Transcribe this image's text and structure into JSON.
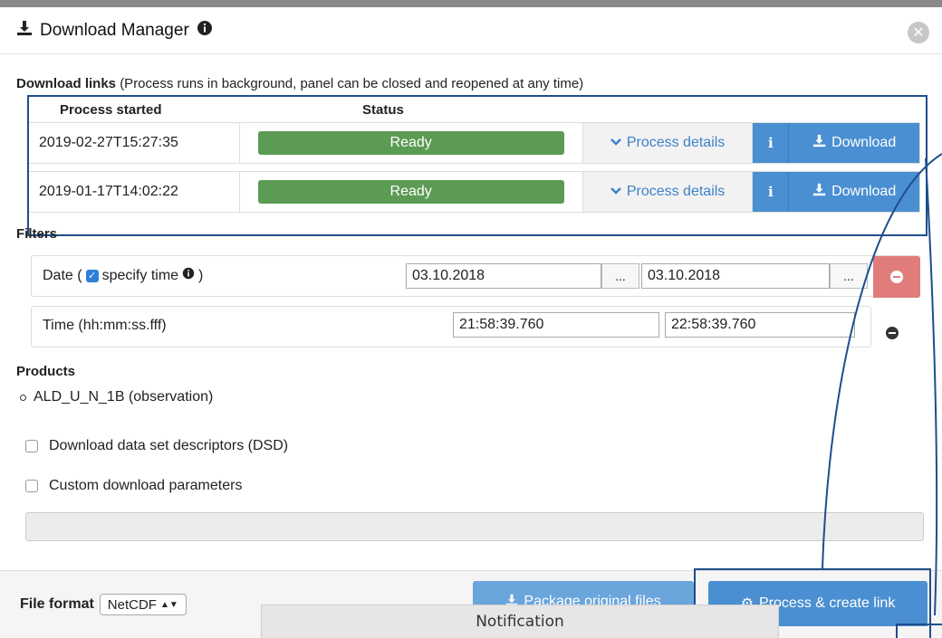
{
  "header": {
    "title": "Download Manager"
  },
  "download_links": {
    "label": "Download links",
    "hint": "(Process runs in background, panel can be closed and reopened at any time)",
    "col_started": "Process started",
    "col_status": "Status",
    "rows": [
      {
        "started": "2019-02-27T15:27:35",
        "status": "Ready",
        "details": "Process details",
        "info": "i",
        "download": "Download"
      },
      {
        "started": "2019-01-17T14:02:22",
        "status": "Ready",
        "details": "Process details",
        "info": "i",
        "download": "Download"
      }
    ]
  },
  "filters": {
    "label": "Filters",
    "date": {
      "label_prefix": "Date (",
      "specify_time": "specify time",
      "label_suffix": ")",
      "from": "03.10.2018",
      "to": "03.10.2018",
      "picker": "..."
    },
    "time": {
      "label": "Time (hh:mm:ss.fff)",
      "from": "21:58:39.760",
      "to": "22:58:39.760"
    }
  },
  "products": {
    "label": "Products",
    "items": [
      "ALD_U_N_1B (observation)"
    ]
  },
  "options": {
    "dsd": "Download data set descriptors (DSD)",
    "custom": "Custom download parameters"
  },
  "footer": {
    "file_format_label": "File format",
    "file_format_value": "NetCDF",
    "package_button": "Package original files",
    "process_button": "Process & create link"
  },
  "notification": "Notification",
  "colors": {
    "ready": "#5b9b53",
    "primary": "#4a8fd1",
    "danger": "#e07d7b",
    "highlight": "#1f4e8c"
  }
}
